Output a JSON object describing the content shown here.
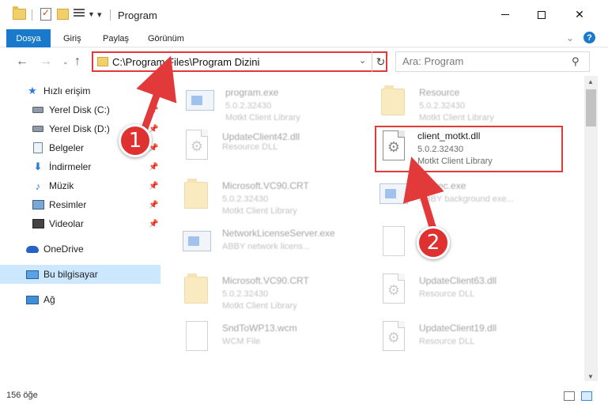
{
  "window": {
    "title": "Program",
    "controls": {
      "minimize": "",
      "maximize": "",
      "close": "✕"
    }
  },
  "ribbon": {
    "tabs": [
      "Dosya",
      "Giriş",
      "Paylaş",
      "Görünüm"
    ],
    "help": "?"
  },
  "address_bar": {
    "path": "C:\\Program Files\\Program Dizini"
  },
  "search": {
    "placeholder": "Ara: Program"
  },
  "sidebar": {
    "items": [
      {
        "label": "Hızlı erişim",
        "icon": "star-icon",
        "pinned": false
      },
      {
        "label": "Yerel Disk (C:)",
        "icon": "drive-icon",
        "pinned": true
      },
      {
        "label": "Yerel Disk (D:)",
        "icon": "drive-icon",
        "pinned": true
      },
      {
        "label": "Belgeler",
        "icon": "documents-icon",
        "pinned": true
      },
      {
        "label": "İndirmeler",
        "icon": "download-icon",
        "pinned": true
      },
      {
        "label": "Müzik",
        "icon": "music-icon",
        "pinned": true
      },
      {
        "label": "Resimler",
        "icon": "pictures-icon",
        "pinned": true
      },
      {
        "label": "Videolar",
        "icon": "videos-icon",
        "pinned": true
      },
      {
        "label": "OneDrive",
        "icon": "onedrive-icon",
        "pinned": false
      },
      {
        "label": "Bu bilgisayar",
        "icon": "this-pc-icon",
        "pinned": false,
        "selected": true
      },
      {
        "label": "Ağ",
        "icon": "network-icon",
        "pinned": false
      }
    ]
  },
  "files": [
    {
      "name": "program.exe",
      "version": "5.0.2.32430",
      "description": "Motkt Client Library",
      "icon": "exe-icon"
    },
    {
      "name": "Resource",
      "version": "5.0.2.32430",
      "description": "Motkt Client Library",
      "icon": "folder-icon"
    },
    {
      "name": "UpdateClient42.dll",
      "version": "",
      "description": "Resource DLL",
      "icon": "dll-icon"
    },
    {
      "name": "client_motkt.dll",
      "version": "5.0.2.32430",
      "description": "Motkt Client Library",
      "icon": "dll-icon",
      "highlighted": true
    },
    {
      "name": "Microsoft.VC90.CRT",
      "version": "5.0.2.32430",
      "description": "Motkt Client Library",
      "icon": "folder-icon"
    },
    {
      "name": "...Exec.exe",
      "version": "",
      "description": "ABBY background exe...",
      "icon": "exe-icon"
    },
    {
      "name": "NetworkLicenseServer.exe",
      "version": "",
      "description": "ABBY network licens...",
      "icon": "exe-icon"
    },
    {
      "name": "d...",
      "version": "",
      "description": "",
      "icon": "blank-file-icon"
    },
    {
      "name": "Microsoft.VC90.CRT",
      "version": "5.0.2.32430",
      "description": "Motkt Client Library",
      "icon": "folder-icon"
    },
    {
      "name": "UpdateClient63.dll",
      "version": "",
      "description": "Resource DLL",
      "icon": "dll-icon"
    },
    {
      "name": "SndToWP13.wcm",
      "version": "",
      "description": "WCM File",
      "icon": "blank-file-icon"
    },
    {
      "name": "UpdateClient19.dll",
      "version": "",
      "description": "Resource DLL",
      "icon": "dll-icon"
    }
  ],
  "annotations": {
    "step1": "1",
    "step2": "2",
    "accent": "#e23a3a"
  },
  "status": {
    "item_count": "156 öğe"
  },
  "colors": {
    "file_tab": "#1979ca",
    "selection": "#cce8ff",
    "highlight": "#e23a3a"
  }
}
